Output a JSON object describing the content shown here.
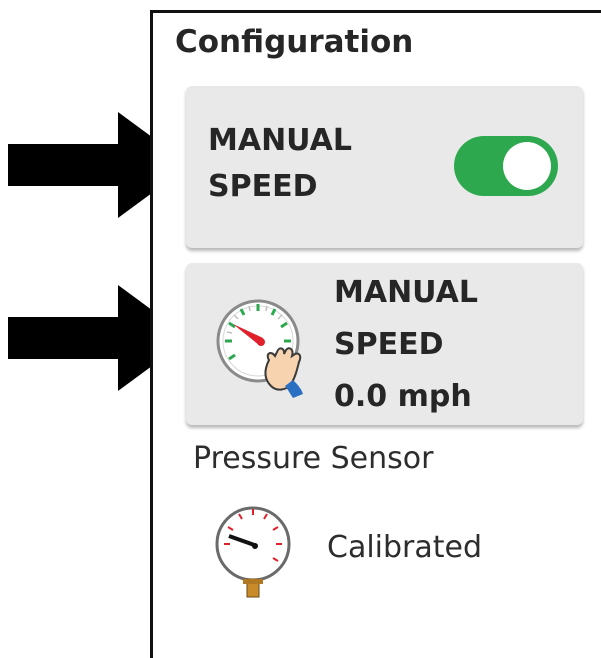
{
  "config": {
    "title": "Configuration",
    "manual_speed_toggle": {
      "line1": "MANUAL",
      "line2": "SPEED",
      "enabled": true
    },
    "manual_speed_card": {
      "line1": "MANUAL",
      "line2": "SPEED",
      "value": "0.0 mph"
    },
    "pressure_sensor": {
      "label": "Pressure Sensor",
      "status": "Calibrated"
    }
  },
  "icons": {
    "toggle_card_arrow": "right-arrow-icon",
    "speed_card_arrow": "right-arrow-icon",
    "speed_gauge": "speedometer-hand-icon",
    "pressure_gauge": "pressure-gauge-icon"
  },
  "colors": {
    "toggle_on": "#2ea84f",
    "card_bg": "#e9e9e9",
    "gauge_needle": "#e0202a",
    "gauge_ticks": "#2ea84f"
  }
}
